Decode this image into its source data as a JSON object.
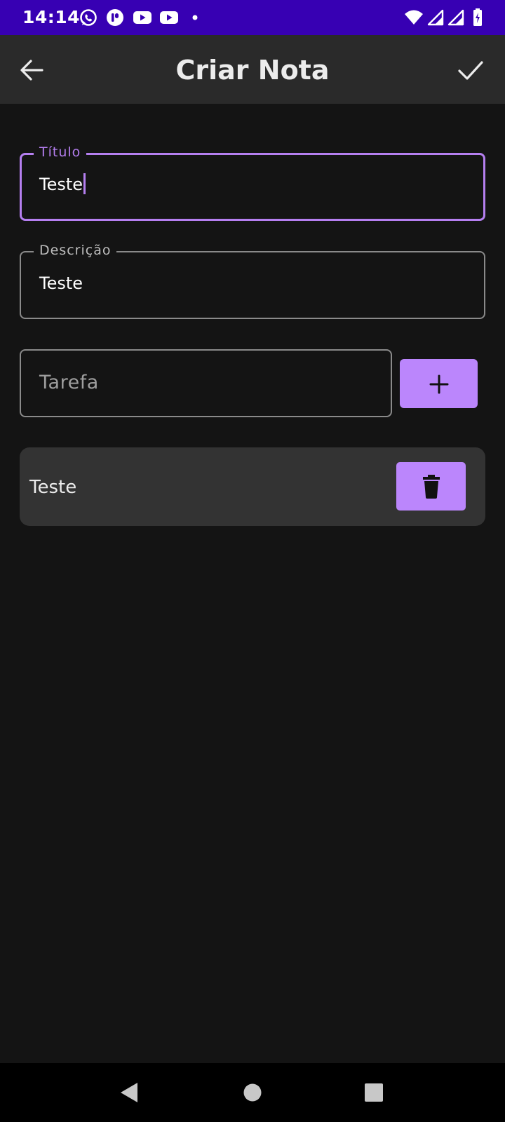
{
  "status_bar": {
    "time": "14:14",
    "background": "#3700b3",
    "left_icons": [
      "whatsapp-icon",
      "app-notification-icon",
      "youtube-icon",
      "youtube-icon",
      "notification-dot-icon"
    ],
    "right_icons": [
      "wifi-icon",
      "signal-icon",
      "signal-icon",
      "battery-charging-icon"
    ]
  },
  "app_bar": {
    "title": "Criar Nota",
    "back_icon": "arrow-back-icon",
    "confirm_icon": "check-icon"
  },
  "form": {
    "title_field": {
      "label": "Título",
      "value": "Teste"
    },
    "description_field": {
      "label": "Descrição",
      "value": "Teste"
    },
    "task_field": {
      "placeholder": "Tarefa",
      "value": ""
    },
    "add_button_icon": "plus-icon"
  },
  "tasks": [
    {
      "label": "Teste",
      "delete_icon": "trash-icon"
    }
  ],
  "colors": {
    "accent": "#bb86fc",
    "focus_outline": "#b57ff0",
    "background": "#141414",
    "app_bar": "#2a2a2a",
    "card": "#333333"
  },
  "nav_bar": {
    "buttons": [
      "back-triangle-icon",
      "home-circle-icon",
      "recents-square-icon"
    ]
  }
}
